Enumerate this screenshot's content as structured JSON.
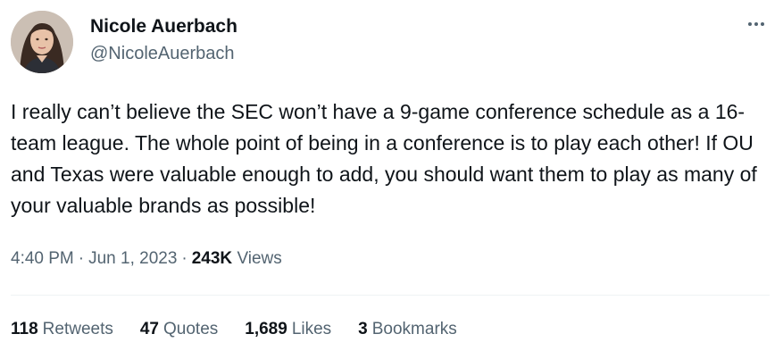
{
  "author": {
    "name": "Nicole Auerbach",
    "handle": "@NicoleAuerbach"
  },
  "tweet": {
    "text": "I really can’t believe the SEC won’t have a 9-game conference schedule as a 16-team league. The whole point of being in a conference is to play each other! If OU and Texas were valuable enough to add, you should want them to play as many of your valuable brands as possible!",
    "time": "4:40 PM",
    "date": "Jun 1, 2023",
    "views_count": "243K",
    "views_label": "Views",
    "separator": "·"
  },
  "stats": {
    "retweets": {
      "count": "118",
      "label": "Retweets"
    },
    "quotes": {
      "count": "47",
      "label": "Quotes"
    },
    "likes": {
      "count": "1,689",
      "label": "Likes"
    },
    "bookmarks": {
      "count": "3",
      "label": "Bookmarks"
    }
  },
  "icons": {
    "more": "more-horizontal-icon"
  },
  "colors": {
    "primary_text": "#0f1419",
    "secondary_text": "#536471",
    "divider": "#eff3f4"
  }
}
